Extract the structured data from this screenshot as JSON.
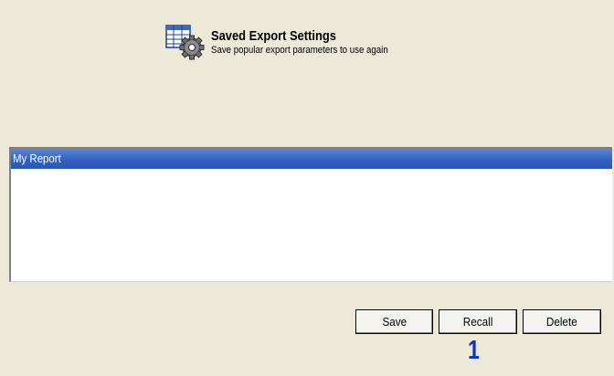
{
  "header": {
    "title": "Saved Export Settings",
    "subtitle": "Save popular export parameters to use again",
    "icon": "grid-gear-icon"
  },
  "list": {
    "items": [
      {
        "label": "My Report",
        "selected": true
      }
    ]
  },
  "buttons": {
    "save_label": "Save",
    "recall_label": "Recall",
    "delete_label": "Delete"
  },
  "annotation": {
    "text": "1",
    "color": "#0a32c8"
  },
  "colors": {
    "background": "#ece9d8",
    "selection": "#2f5fbf"
  }
}
